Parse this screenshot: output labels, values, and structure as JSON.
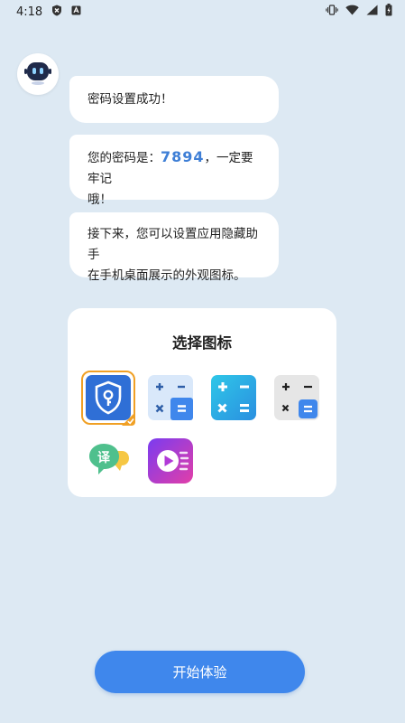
{
  "status_bar": {
    "time": "4:18"
  },
  "messages": {
    "success": "密码设置成功！",
    "password_prefix": "您的密码是：",
    "password": "7894",
    "password_suffix": "，一定要牢记",
    "password_suffix_line2": "哦！",
    "next_line1": "接下来，您可以设置应用隐藏助手",
    "next_line2": "在手机桌面展示的外观图标。"
  },
  "picker": {
    "title": "选择图标",
    "selected_index": 0,
    "icons": [
      "shield-lock-icon",
      "calculator-light-icon",
      "calculator-blue-icon",
      "calculator-gray-icon",
      "translate-chat-icon",
      "video-player-icon"
    ],
    "translate_glyph": "译"
  },
  "cta": {
    "label": "开始体验"
  },
  "colors": {
    "accent": "#3f87ec",
    "selection": "#f0a025",
    "background": "#dde9f3"
  }
}
